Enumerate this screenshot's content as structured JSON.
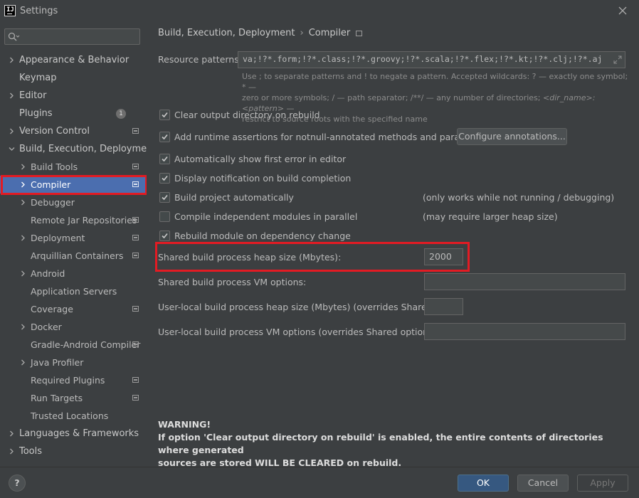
{
  "window": {
    "title": "Settings",
    "logo_text": "IJ"
  },
  "search": {
    "placeholder": "",
    "value": ""
  },
  "sidebar": {
    "items": [
      {
        "label": "Appearance & Behavior",
        "level": 0,
        "expandable": true,
        "expanded": false
      },
      {
        "label": "Keymap",
        "level": 0,
        "expandable": false
      },
      {
        "label": "Editor",
        "level": 0,
        "expandable": true,
        "expanded": false
      },
      {
        "label": "Plugins",
        "level": 0,
        "expandable": false,
        "badge": "1"
      },
      {
        "label": "Version Control",
        "level": 0,
        "expandable": true,
        "expanded": false,
        "project_icon": true
      },
      {
        "label": "Build, Execution, Deployment",
        "level": 0,
        "expandable": true,
        "expanded": true
      },
      {
        "label": "Build Tools",
        "level": 1,
        "expandable": true,
        "project_icon": true
      },
      {
        "label": "Compiler",
        "level": 1,
        "expandable": true,
        "project_icon": true,
        "selected": true
      },
      {
        "label": "Debugger",
        "level": 1,
        "expandable": true
      },
      {
        "label": "Remote Jar Repositories",
        "level": 1,
        "expandable": false,
        "project_icon": true
      },
      {
        "label": "Deployment",
        "level": 1,
        "expandable": true,
        "project_icon": true
      },
      {
        "label": "Arquillian Containers",
        "level": 1,
        "expandable": false,
        "project_icon": true
      },
      {
        "label": "Android",
        "level": 1,
        "expandable": true
      },
      {
        "label": "Application Servers",
        "level": 1,
        "expandable": false
      },
      {
        "label": "Coverage",
        "level": 1,
        "expandable": false,
        "project_icon": true
      },
      {
        "label": "Docker",
        "level": 1,
        "expandable": true
      },
      {
        "label": "Gradle-Android Compiler",
        "level": 1,
        "expandable": false,
        "project_icon": true
      },
      {
        "label": "Java Profiler",
        "level": 1,
        "expandable": true
      },
      {
        "label": "Required Plugins",
        "level": 1,
        "expandable": false,
        "project_icon": true
      },
      {
        "label": "Run Targets",
        "level": 1,
        "expandable": false,
        "project_icon": true
      },
      {
        "label": "Trusted Locations",
        "level": 1,
        "expandable": false
      },
      {
        "label": "Languages & Frameworks",
        "level": 0,
        "expandable": true,
        "expanded": false
      },
      {
        "label": "Tools",
        "level": 0,
        "expandable": true,
        "expanded": false
      }
    ]
  },
  "breadcrumb": {
    "parent": "Build, Execution, Deployment",
    "separator": "›",
    "current": "Compiler"
  },
  "resource_patterns": {
    "label": "Resource patterns:",
    "value": "va;!?*.form;!?*.class;!?*.groovy;!?*.scala;!?*.flex;!?*.kt;!?*.clj;!?*.aj",
    "hint_1": "Use ; to separate patterns and ! to negate a pattern. Accepted wildcards: ? — exactly one symbol; * —",
    "hint_2": "zero or more symbols; / — path separator; /**/ — any number of directories; ",
    "hint_2_italic": "<dir_name>:<pattern>",
    "hint_2_end": " —",
    "hint_3": "restrict to source roots with the specified name"
  },
  "options": {
    "clear_output": {
      "label": "Clear output directory on rebuild",
      "checked": true
    },
    "runtime_assertions": {
      "label": "Add runtime assertions for notnull-annotated methods and parameters",
      "checked": true,
      "button": "Configure annotations..."
    },
    "show_first_error": {
      "label": "Automatically show first error in editor",
      "checked": true
    },
    "build_notification": {
      "label": "Display notification on build completion",
      "checked": true
    },
    "build_automatically": {
      "label": "Build project automatically",
      "checked": true,
      "note": "(only works while not running / debugging)"
    },
    "parallel": {
      "label": "Compile independent modules in parallel",
      "checked": false,
      "note": "(may require larger heap size)"
    },
    "rebuild_module": {
      "label": "Rebuild module on dependency change",
      "checked": true
    }
  },
  "heap": {
    "label": "Shared build process heap size (Mbytes):",
    "value": "2000"
  },
  "vm_options": {
    "label": "Shared build process VM options:",
    "value": ""
  },
  "local_heap": {
    "label": "User-local build process heap size (Mbytes) (overrides Shared size):",
    "value": ""
  },
  "local_vm": {
    "label": "User-local build process VM options (overrides Shared options):",
    "value": ""
  },
  "warning": {
    "title": "WARNING!",
    "line1": "If option 'Clear output directory on rebuild' is enabled, the entire contents of directories where generated",
    "line2": "sources are stored WILL BE CLEARED on rebuild."
  },
  "footer": {
    "help": "?",
    "ok": "OK",
    "cancel": "Cancel",
    "apply": "Apply"
  },
  "colors": {
    "background": "#3c3f41",
    "selection": "#4b6eaf",
    "highlight": "#e31b23",
    "primary_button": "#365880",
    "input": "#45494a"
  }
}
